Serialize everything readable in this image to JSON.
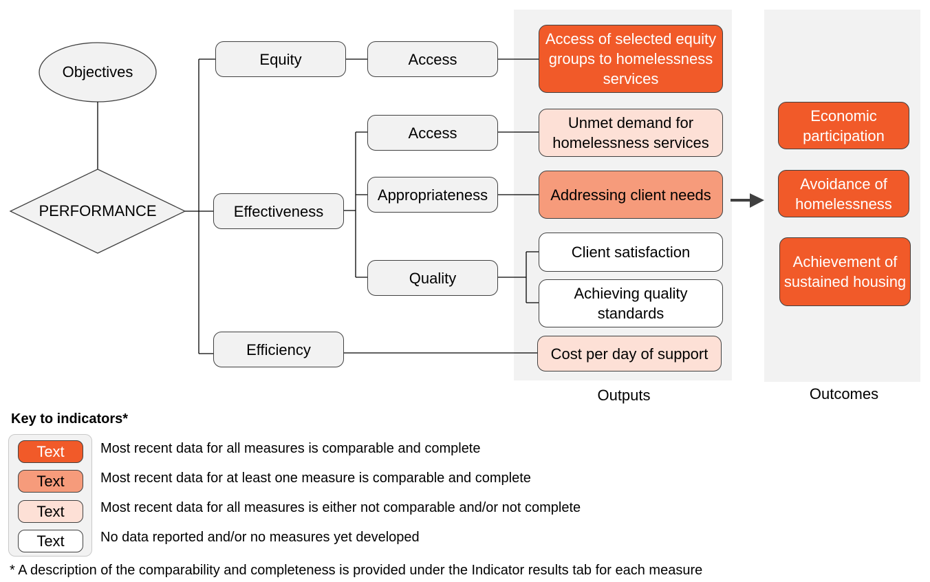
{
  "diagram": {
    "objectives": "Objectives",
    "performance": "PERFORMANCE",
    "branches": {
      "equity": "Equity",
      "effectiveness": "Effectiveness",
      "efficiency": "Efficiency"
    },
    "sub": {
      "equity_access": "Access",
      "eff_access": "Access",
      "appropriateness": "Appropriateness",
      "quality": "Quality"
    },
    "outputs": {
      "heading": "Outputs",
      "items": [
        {
          "label": "Access of selected equity groups to homelessness services",
          "level": "all-comparable"
        },
        {
          "label": "Unmet demand for homelessness services",
          "level": "not-comparable"
        },
        {
          "label": "Addressing client needs",
          "level": "at-least-one"
        },
        {
          "label": "Client satisfaction",
          "level": "no-data"
        },
        {
          "label": "Achieving quality standards",
          "level": "no-data"
        },
        {
          "label": "Cost per day of support",
          "level": "not-comparable"
        }
      ]
    },
    "outcomes": {
      "heading": "Outcomes",
      "items": [
        {
          "label": "Economic participation",
          "level": "all-comparable"
        },
        {
          "label": "Avoidance of homelessness",
          "level": "all-comparable"
        },
        {
          "label": "Achievement of sustained housing",
          "level": "all-comparable"
        }
      ]
    },
    "arrow_icon": "right-arrow"
  },
  "legend": {
    "title": "Key to indicators*",
    "items": [
      {
        "sample": "Text",
        "description": "Most recent data for all measures is comparable and complete",
        "color": "#f15a29"
      },
      {
        "sample": "Text",
        "description": "Most recent data for at least one measure is comparable and complete",
        "color": "#f69b7b"
      },
      {
        "sample": "Text",
        "description": "Most recent data for all measures is either not comparable and/or not complete",
        "color": "#fde0d6"
      },
      {
        "sample": "Text",
        "description": "No data reported and/or no measures yet developed",
        "color": "#ffffff"
      }
    ],
    "footnote": "* A description of the comparability and completeness is provided under the Indicator results tab for each measure"
  },
  "colors": {
    "all_comparable": "#f15a29",
    "at_least_one": "#f69b7b",
    "not_comparable": "#fde0d6",
    "no_data": "#ffffff",
    "node_grey": "#f2f2f2"
  }
}
